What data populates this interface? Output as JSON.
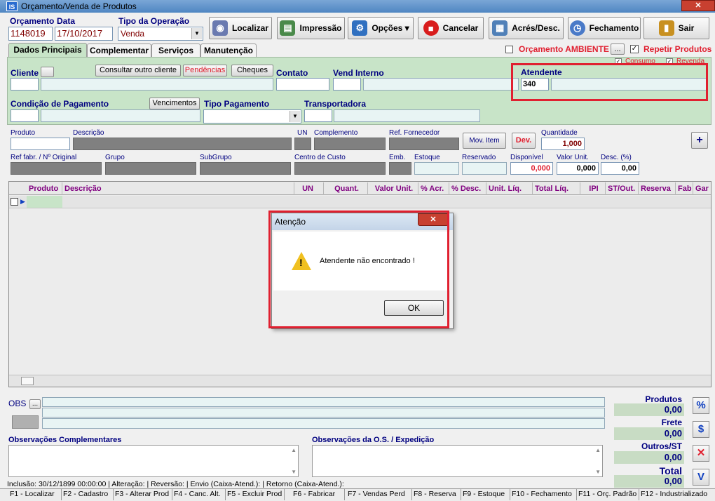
{
  "window": {
    "title": "Orçamento/Venda de Produtos",
    "app_icon": "IS"
  },
  "header_fields": {
    "orcamento_label": "Orçamento",
    "orcamento_value": "1148019",
    "data_label": "Data",
    "data_value": "17/10/2017",
    "tipo_operacao_label": "Tipo da Operação",
    "tipo_operacao_value": "Venda"
  },
  "toolbar": {
    "localizar": "Localizar",
    "impressao": "Impressão",
    "opcoes": "Opções ▾",
    "cancelar": "Cancelar",
    "acres_desc": "Acrés/Desc.",
    "fechamento": "Fechamento",
    "sair": "Sair"
  },
  "tabs": [
    "Dados Principais",
    "Complementar",
    "Serviços",
    "Manutenção"
  ],
  "options": {
    "orcamento_ambiente": "Orçamento AMBIENTE",
    "repetir_produtos": "Repetir Produtos",
    "consumo": "Consumo",
    "revenda": "Revenda",
    "ellipsis": "..."
  },
  "main": {
    "cliente_label": "Cliente",
    "consultar_outro_cliente": "Consultar outro cliente",
    "pendencias": "Pendências",
    "cheques": "Cheques",
    "contato_label": "Contato",
    "vend_interno_label": "Vend Interno",
    "atendente_label": "Atendente",
    "atendente_value": "340",
    "condicao_pagamento_label": "Condição de Pagamento",
    "vencimentos": "Vencimentos",
    "tipo_pagamento_label": "Tipo Pagamento",
    "transportadora_label": "Transportadora"
  },
  "item": {
    "produto": "Produto",
    "descricao": "Descrição",
    "un": "UN",
    "complemento": "Complemento",
    "ref_fornecedor": "Ref. Fornecedor",
    "mov_item": "Mov. Item",
    "dev": "Dev.",
    "quantidade": "Quantidade",
    "quantidade_value": "1,000",
    "ref_fabr": "Ref fabr. / Nº Original",
    "grupo": "Grupo",
    "subgrupo": "SubGrupo",
    "centro_custo": "Centro de Custo",
    "emb": "Emb.",
    "estoque": "Estoque",
    "reservado": "Reservado",
    "disponivel": "Disponível",
    "disponivel_value": "0,000",
    "valor_unit": "Valor Unit.",
    "valor_unit_value": "0,000",
    "desc_pct": "Desc. (%)",
    "desc_pct_value": "0,00",
    "add": "+"
  },
  "grid": {
    "columns": [
      "Produto",
      "Descrição",
      "UN",
      "Quant.",
      "Valor Unit.",
      "% Acr.",
      "% Desc.",
      "Unit. Líq.",
      "Total Líq.",
      "IPI",
      "ST/Out.",
      "Reserva",
      "Fab",
      "Gar"
    ]
  },
  "dialog": {
    "title": "Atenção",
    "message": "Atendente não encontrado !",
    "ok": "OK",
    "close": "✕"
  },
  "obs": {
    "label": "OBS",
    "ellipsis": "...",
    "complementares": "Observações Complementares",
    "os_expedicao": "Observações da O.S. / Expedição"
  },
  "totals": {
    "produtos_label": "Produtos",
    "produtos_value": "0,00",
    "frete_label": "Frete",
    "frete_value": "0,00",
    "outros_label": "Outros/ST",
    "outros_value": "0,00",
    "total_label": "Total",
    "total_value": "0,00"
  },
  "side_buttons": {
    "pct": "%",
    "dollar": "$",
    "x": "✕",
    "v": "V"
  },
  "status": {
    "line": "Inclusão:  30/12/1899 00:00:00 | Alteração:  | Reversão:  | Envio (Caixa-Atend.):  | Retorno (Caixa-Atend.):"
  },
  "fkeys": [
    "F1 - Localizar",
    "F2 - Cadastro",
    "F3 - Alterar Prod",
    "F4 - Canc. Alt.",
    "F5 - Excluir Prod",
    "F6 - Fabricar",
    "F7 - Vendas Perd",
    "F8 - Reserva",
    "F9 - Estoque",
    "F10 - Fechamento",
    "F11 - Orç. Padrão",
    "F12 - Industrializado"
  ],
  "colors": {
    "accent_red": "#e02030",
    "label_blue": "#000080",
    "panel_green": "#c8e4c8"
  }
}
